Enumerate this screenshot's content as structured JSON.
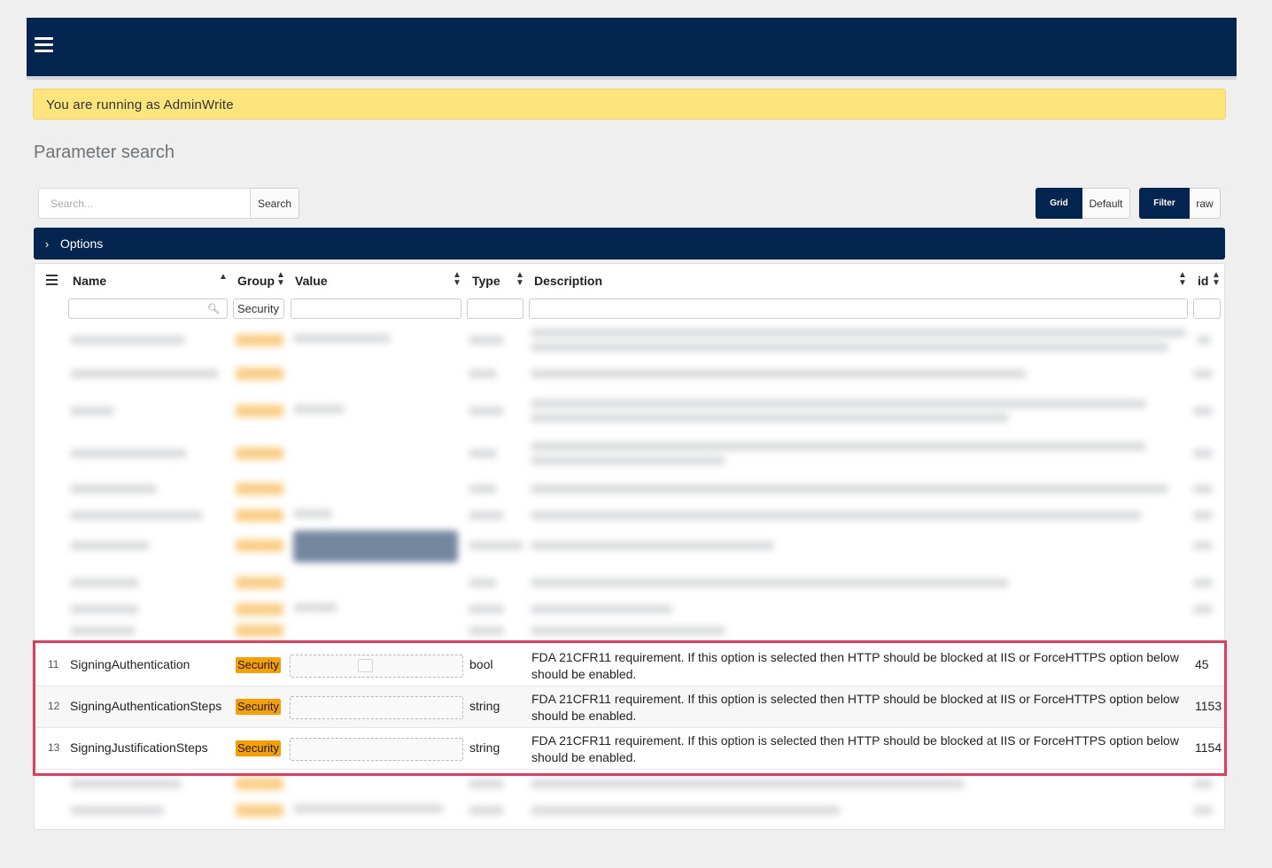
{
  "alert": "You are running as AdminWrite",
  "page_title": "Parameter search",
  "search": {
    "placeholder": "Search...",
    "button": "Search"
  },
  "view_toggle": {
    "grid": "Grid",
    "default": "Default"
  },
  "mode_toggle": {
    "filter": "Filter",
    "raw": "raw"
  },
  "options_label": "Options",
  "options_chevron": "›",
  "grid": {
    "columns": {
      "name": "Name",
      "group": "Group",
      "value": "Value",
      "type": "Type",
      "description": "Description",
      "id": "id"
    },
    "group_filter": "Security",
    "rows": [
      {
        "num": "11",
        "name": "SigningAuthentication",
        "group": "Security",
        "type": "bool",
        "description": "FDA 21CFR11 requirement. If this option is selected then HTTP should be blocked at IIS or ForceHTTPS option below should be enabled.",
        "id": "45"
      },
      {
        "num": "12",
        "name": "SigningAuthenticationSteps",
        "group": "Security",
        "type": "string",
        "description": "FDA 21CFR11 requirement. If this option is selected then HTTP should be blocked at IIS or ForceHTTPS option below should be enabled.",
        "id": "1153"
      },
      {
        "num": "13",
        "name": "SigningJustificationSteps",
        "group": "Security",
        "type": "string",
        "description": "FDA 21CFR11 requirement. If this option is selected then HTTP should be blocked at IIS or ForceHTTPS option below should be enabled.",
        "id": "1154"
      }
    ]
  },
  "icons": {
    "menu": "hamburger-menu-icon",
    "search": "magnifier-icon",
    "sort": "sort-arrows-icon",
    "chevron": "chevron-right-icon"
  },
  "colors": {
    "navy": "#032550",
    "alert": "#fde57d",
    "badge": "#f5a000",
    "highlight": "#e83a5f"
  }
}
